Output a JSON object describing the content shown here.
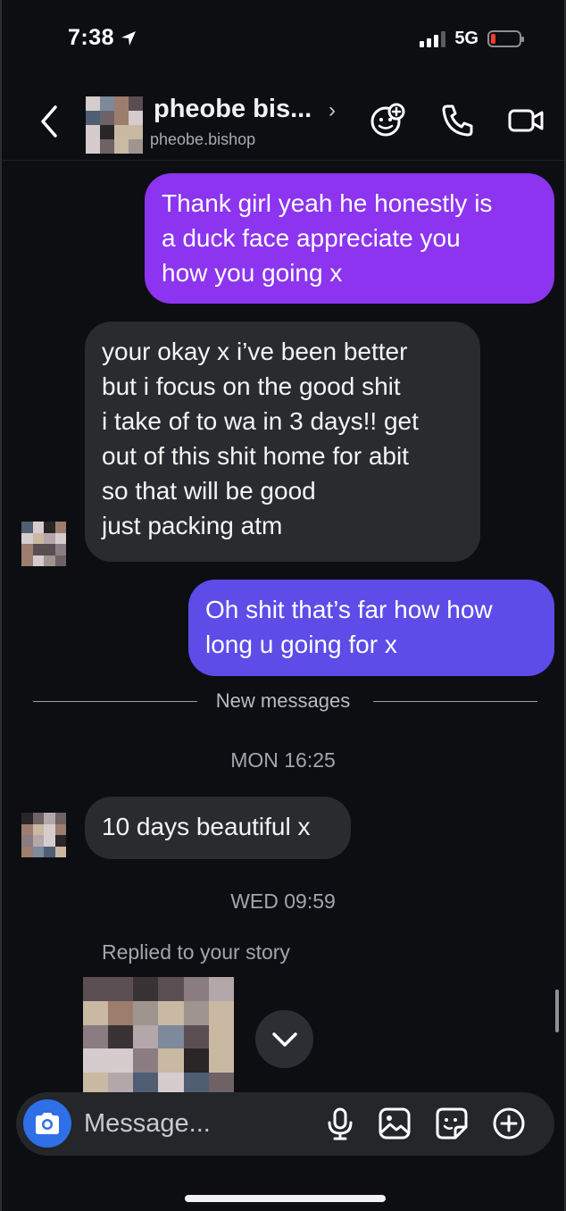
{
  "status_bar": {
    "time": "7:38",
    "network": "5G",
    "battery_level": 0.15,
    "battery_color": "#ff3b30",
    "signal_bars_active": 3
  },
  "header": {
    "back_icon": "chevron-left-icon",
    "name": "pheobe bis...",
    "name_chevron": "›",
    "username": "pheobe.bishop",
    "icons": [
      "ai-sticker-icon",
      "phone-icon",
      "video-camera-icon"
    ]
  },
  "messages": {
    "out1": "Thank girl yeah he honestly is\na duck face appreciate you\nhow you going x",
    "in1": "your okay x i’ve been better\nbut i focus on the good shit\ni take of to wa in 3 days!! get\nout of this shit home for abit\nso that will be good\njust packing atm",
    "out2": "Oh shit that’s far how how\nlong u going for x",
    "new_messages_label": "New messages",
    "timestamp1": "MON 16:25",
    "in2": "10 days beautiful x",
    "timestamp2": "WED 09:59",
    "reply_note": "Replied to your story"
  },
  "composer": {
    "placeholder": "Message...",
    "icons": [
      "camera-icon",
      "microphone-icon",
      "gallery-icon",
      "sticker-icon",
      "plus-circle-icon"
    ]
  },
  "colors": {
    "outgoing_purple": "#8c34ef",
    "outgoing_indigo": "#5d4ce8",
    "incoming": "#2a2b2f",
    "background": "#0c0e12",
    "camera_button": "#2f6fe8"
  }
}
